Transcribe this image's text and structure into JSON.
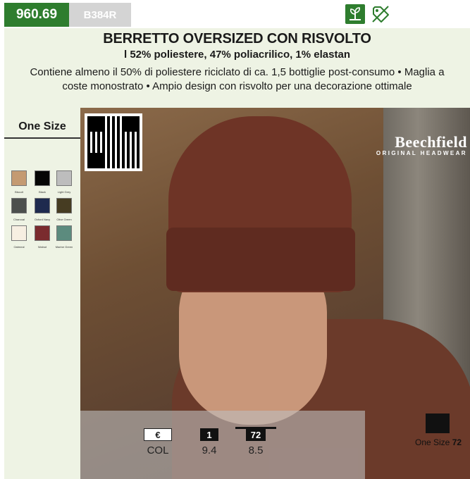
{
  "top": {
    "article_number": "960.69",
    "sku": "B384R",
    "eco_icon": "eco-sprout-icon",
    "tag_icon": "no-label-tag-icon"
  },
  "header": {
    "title": "BERRETTO OVERSIZED CON RISVOLTO",
    "subtitle": "l 52% poliestere, 47% poliacrilico, 1% elastan",
    "description": "Contiene almeno il 50% di poliestere riciclato di ca. 1,5 bottiglie post-consumo • Maglia a coste monostrato • Ampio design con risvolto per una decorazione ottimale"
  },
  "sidebar": {
    "size": "One Size",
    "colors": [
      {
        "name": "Biscuit",
        "hex": "#c49a72"
      },
      {
        "name": "Black",
        "hex": "#050505"
      },
      {
        "name": "Light Grey",
        "hex": "#bdbdbd"
      },
      {
        "name": "Charcoal",
        "hex": "#4c4f4d"
      },
      {
        "name": "Oxford Navy",
        "hex": "#1e2a4e"
      },
      {
        "name": "Olive Green",
        "hex": "#463c22"
      },
      {
        "name": "Oatmeal",
        "hex": "#f7efe2"
      },
      {
        "name": "Walnut",
        "hex": "#7a2b2e"
      },
      {
        "name": "Marine Green",
        "hex": "#5c8b7e"
      }
    ]
  },
  "brand": {
    "name": "Beechfield",
    "tagline": "ORIGINAL HEADWEAR"
  },
  "pricing": {
    "currency_symbol": "€",
    "currency_label": "COL",
    "qty1_label": "1",
    "qty1_value": "9.4",
    "qty72_label": "72",
    "qty72_value": "8.5"
  },
  "packaging": {
    "size_label": "One Size",
    "quantity": "72"
  }
}
